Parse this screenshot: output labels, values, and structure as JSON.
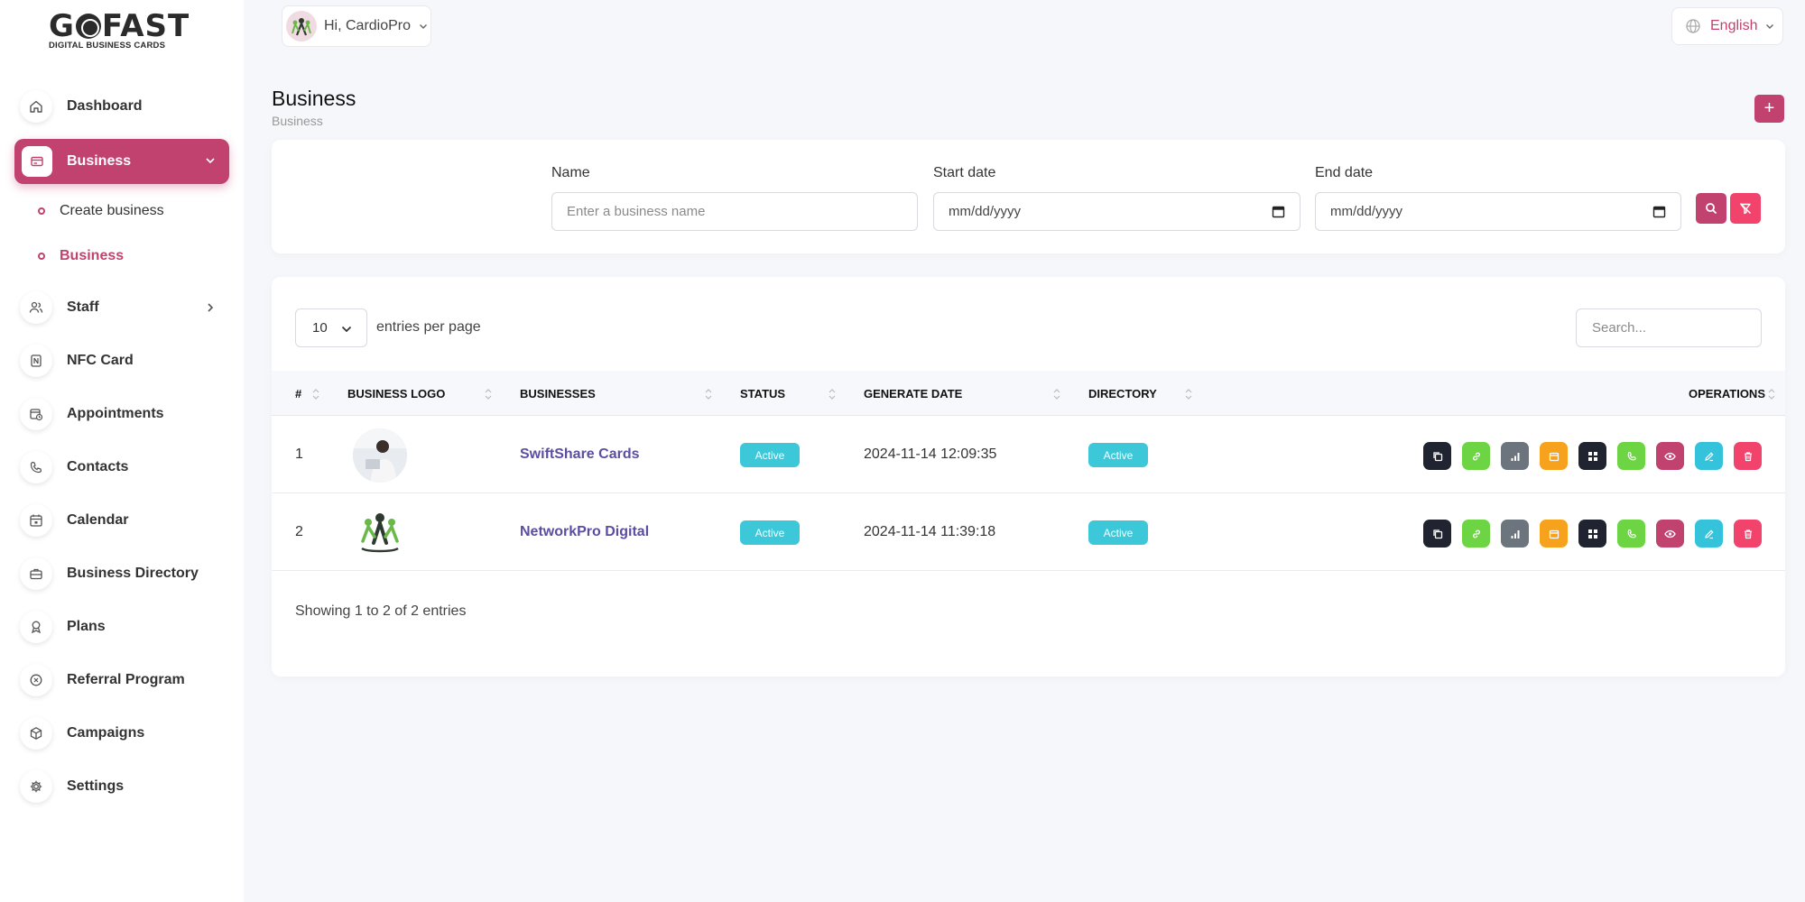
{
  "brand": {
    "logo_main_left": "G",
    "logo_main_right": "FAST",
    "logo_sub": "DIGITAL BUSINESS CARDS"
  },
  "header": {
    "greeting": "Hi, CardioPro",
    "language": "English"
  },
  "sidebar": {
    "items": [
      {
        "label": "Dashboard",
        "icon": "home-icon"
      },
      {
        "label": "Business",
        "icon": "card-icon",
        "active": true
      },
      {
        "label": "Staff",
        "icon": "users-icon"
      },
      {
        "label": "NFC Card",
        "icon": "nfc-icon"
      },
      {
        "label": "Appointments",
        "icon": "calendar-clock-icon"
      },
      {
        "label": "Contacts",
        "icon": "phone-icon"
      },
      {
        "label": "Calendar",
        "icon": "calendar-icon"
      },
      {
        "label": "Business Directory",
        "icon": "briefcase-icon"
      },
      {
        "label": "Plans",
        "icon": "award-icon"
      },
      {
        "label": "Referral Program",
        "icon": "referral-icon"
      },
      {
        "label": "Campaigns",
        "icon": "box-icon"
      },
      {
        "label": "Settings",
        "icon": "gear-icon"
      }
    ],
    "submenu": [
      {
        "label": "Create business"
      },
      {
        "label": "Business",
        "active": true
      }
    ]
  },
  "page": {
    "title": "Business",
    "breadcrumb": "Business",
    "add_label": "+"
  },
  "filters": {
    "name_label": "Name",
    "name_placeholder": "Enter a business name",
    "start_label": "Start date",
    "start_value": "mm/dd/yyyy",
    "end_label": "End date",
    "end_value": "mm/dd/yyyy"
  },
  "table": {
    "per_page_value": "10",
    "per_page_label": "entries per page",
    "search_placeholder": "Search...",
    "columns": [
      "#",
      "Business Logo",
      "Businesses",
      "Status",
      "Generate Date",
      "Directory",
      "Operations"
    ],
    "rows": [
      {
        "num": "1",
        "name": "SwiftShare Cards",
        "status": "Active",
        "date": "2024-11-14 12:09:35",
        "directory": "Active"
      },
      {
        "num": "2",
        "name": "NetworkPro Digital",
        "status": "Active",
        "date": "2024-11-14 11:39:18",
        "directory": "Active"
      }
    ],
    "operations": [
      {
        "icon": "copy-icon",
        "color": "#1f2430"
      },
      {
        "icon": "link-icon",
        "color": "#6dd544"
      },
      {
        "icon": "bar-chart-icon",
        "color": "#6c757d"
      },
      {
        "icon": "calendar-icon",
        "color": "#f7a21d"
      },
      {
        "icon": "qr-icon",
        "color": "#1f2430"
      },
      {
        "icon": "phone-icon",
        "color": "#6dd544"
      },
      {
        "icon": "eye-icon",
        "color": "#c2426f"
      },
      {
        "icon": "edit-icon",
        "color": "#35c3dc"
      },
      {
        "icon": "trash-icon",
        "color": "#f2436d"
      }
    ],
    "footer": "Showing 1 to 2 of 2 entries"
  },
  "colors": {
    "accent": "#c2426f",
    "badge": "#3cc8d9",
    "link": "#5a4ea3"
  }
}
